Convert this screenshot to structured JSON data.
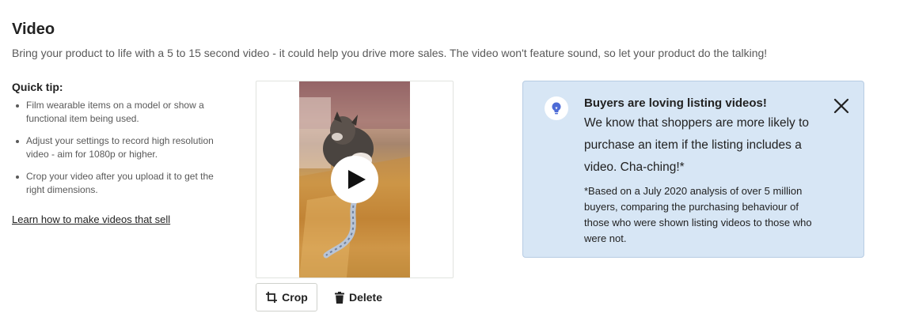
{
  "section": {
    "title": "Video",
    "subtitle": "Bring your product to life with a 5 to 15 second video - it could help you drive more sales. The video won't feature sound, so let your product do the talking!"
  },
  "tips": {
    "heading": "Quick tip:",
    "items": [
      "Film wearable items on a model or show a functional item being used.",
      "Adjust your settings to record high resolution video - aim for 1080p or higher.",
      "Crop your video after you upload it to get the right dimensions."
    ],
    "link_label": "Learn how to make videos that sell"
  },
  "video": {
    "play_icon": "play-icon",
    "crop_label": "Crop",
    "delete_label": "Delete"
  },
  "info_card": {
    "heading": "Buyers are loving listing videos!",
    "body": "We know that shoppers are more likely to purchase an item if the listing includes a video. Cha-ching!*",
    "footnote": "*Based on a July 2020 analysis of over 5 million buyers, comparing the purchasing behaviour of those who were shown listing videos to those who were not.",
    "icon": "lightbulb-icon",
    "close_icon": "close-icon"
  },
  "colors": {
    "card_background": "#d7e6f5",
    "card_border": "#b7cce3",
    "icon_accent": "#4d6bd6",
    "text_primary": "#222222",
    "text_secondary": "#595959"
  }
}
